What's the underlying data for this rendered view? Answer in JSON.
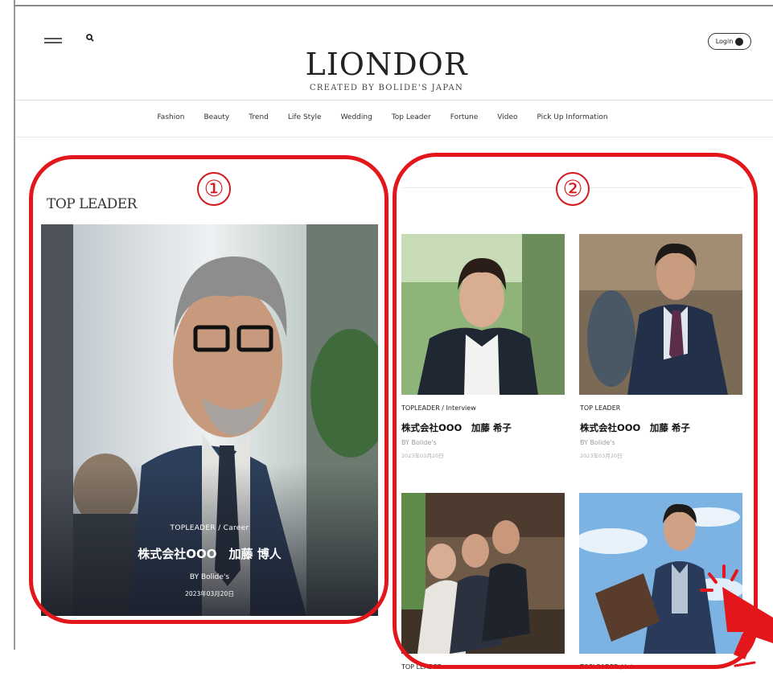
{
  "header": {
    "logo": "LIONDOR",
    "tagline": "CREATED BY BOLIDE'S JAPAN",
    "login_label": "Login"
  },
  "nav": [
    "Fashion",
    "Beauty",
    "Trend",
    "Life Style",
    "Wedding",
    "Top Leader",
    "Fortune",
    "Video",
    "Pick Up Information"
  ],
  "section": {
    "title": "TOP LEADER"
  },
  "hero": {
    "category": "TOPLEADER / Career",
    "title": "株式会社OOO　加藤 博人",
    "author": "BY  Bolide's",
    "date": "2023年03月20日"
  },
  "cards": [
    {
      "category": "TOPLEADER / Interview",
      "title": "株式会社OOO　加藤 希子",
      "author": "BY  Bolide's",
      "date": "2023年03月20日"
    },
    {
      "category": "TOP LEADER",
      "title": "株式会社OOO　加藤 希子",
      "author": "BY  Bolide's",
      "date": "2023年03月20日"
    },
    {
      "category": "TOP LEADER"
    },
    {
      "category": "TOPLEADER / Inte"
    }
  ],
  "annotations": {
    "marker_1": "①",
    "marker_2": "②"
  },
  "colors": {
    "annotation_red": "#e3161b",
    "text_dark": "#222222"
  }
}
